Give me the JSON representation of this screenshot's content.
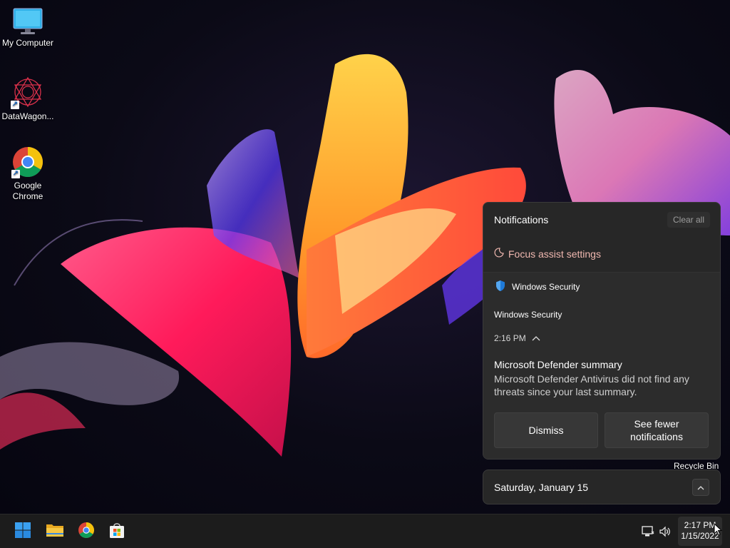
{
  "desktop": {
    "icons": [
      {
        "label": "My Computer"
      },
      {
        "label": "DataWagon..."
      },
      {
        "label": "Google Chrome",
        "label_line1": "Google",
        "label_line2": "Chrome"
      }
    ],
    "recycle_bin_label": "Recycle Bin"
  },
  "notifications": {
    "header": "Notifications",
    "clear_all": "Clear all",
    "focus_assist": "Focus assist settings",
    "card": {
      "app_name": "Windows Security",
      "source": "Windows Security",
      "time": "2:16 PM",
      "title": "Microsoft Defender summary",
      "body": "Microsoft Defender Antivirus did not find any threats since your last summary.",
      "dismiss": "Dismiss",
      "see_fewer": "See fewer notifications"
    }
  },
  "calendar": {
    "date": "Saturday, January 15"
  },
  "taskbar": {
    "clock_time": "2:17 PM",
    "clock_date": "1/15/2022",
    "pinned": [
      "start-icon",
      "file-explorer-icon",
      "chrome-icon",
      "store-icon"
    ],
    "tray": [
      "network-icon",
      "volume-icon"
    ]
  },
  "colors": {
    "accent_blue": "#0078d4",
    "panel_bg": "#272727",
    "focus_assist_text": "#f0b8b0"
  }
}
